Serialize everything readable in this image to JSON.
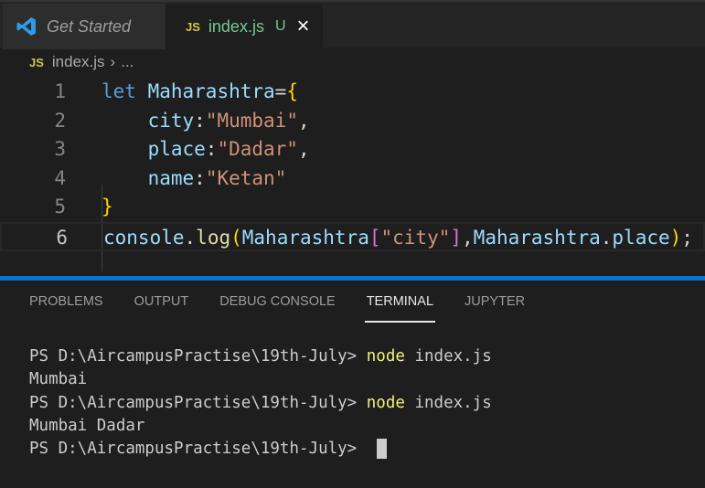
{
  "tabs": [
    {
      "label": "Get Started",
      "icon": "vscode-logo-icon"
    },
    {
      "label": "index.js",
      "icon": "js-icon",
      "badge": "U",
      "close": "×"
    }
  ],
  "breadcrumb": {
    "icon": "JS",
    "file": "index.js",
    "sep": "›",
    "more": "..."
  },
  "code": {
    "numbers": [
      "1",
      "2",
      "3",
      "4",
      "5",
      "6"
    ]
  },
  "panel": {
    "tabs": [
      "PROBLEMS",
      "OUTPUT",
      "DEBUG CONSOLE",
      "TERMINAL",
      "JUPYTER"
    ],
    "active": "TERMINAL"
  },
  "terminal": {
    "prompt": "PS D:\\AircampusPractise\\19th-July> ",
    "cmd": "node",
    "arg": " index.js",
    "out1": "Mumbai",
    "out2": "Mumbai Dadar"
  },
  "colors": {
    "accent": "#0078d4"
  }
}
